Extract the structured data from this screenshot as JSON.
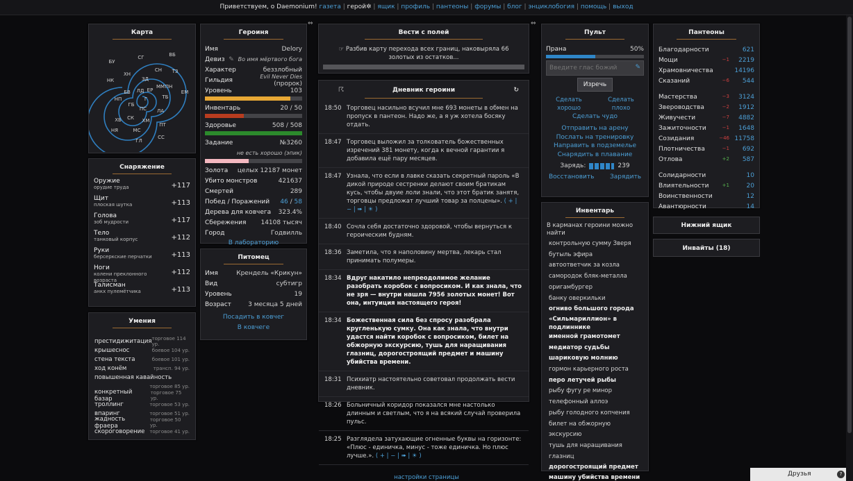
{
  "top": {
    "greet": "Приветствуем, о Daemonium!",
    "links": [
      "газета",
      "ящик",
      "профиль",
      "пантеоны",
      "форумы",
      "блог",
      "энциклобогия",
      "помощь",
      "выход"
    ],
    "hero": "герой"
  },
  "map": {
    "title": "Карта",
    "labels": [
      "СГ",
      "ВБ",
      "БУ",
      "СН",
      "ТЗ",
      "ХН",
      "ЗД",
      "НК",
      "ММ",
      "ПН",
      "ЕМ",
      "БВ",
      "ЛД",
      "ЕР",
      "ТБ",
      "НП",
      "Г",
      "ГБ",
      "ПС",
      "ЛА",
      "ХБ",
      "СК",
      "ХМ",
      "ПТ",
      "НЯ",
      "МС",
      "СС",
      "ГЛ"
    ]
  },
  "hero": {
    "title": "Героиня",
    "rows": [
      {
        "k": "Имя",
        "v": "Delory"
      },
      {
        "k": "Девиз",
        "v": "Во имя мёртвого бога"
      },
      {
        "k": "Характер",
        "v": "беззлобный"
      },
      {
        "k": "Гильдия",
        "v": "Evil Never Dies",
        "v2": "(пророк)"
      },
      {
        "k": "Уровень",
        "v": "103"
      },
      {
        "k": "Инвентарь",
        "v": "20 / 50"
      },
      {
        "k": "Здоровье",
        "v": "508 / 508"
      },
      {
        "k": "Задание",
        "v": "№3260"
      },
      {
        "v": "не есть хорошо (эпик)"
      },
      {
        "k": "Золота",
        "v": "целых 12187 монет"
      },
      {
        "k": "Убито монстров",
        "v": "421637"
      },
      {
        "k": "Смертей",
        "v": "289"
      },
      {
        "k": "Побед / Поражений",
        "v": "46",
        "v2": "58"
      },
      {
        "k": "Дерева для ковчега",
        "v": "323.4%"
      },
      {
        "k": "Сбережения",
        "v": "14108 тысяч"
      },
      {
        "k": "Город",
        "v": "Годвилль"
      }
    ],
    "lab": "В лабораторию",
    "lvl_pct": 88,
    "inv_pct": 40,
    "hp_pct": 100,
    "quest_pct": 45
  },
  "pet": {
    "title": "Питомец",
    "rows": [
      {
        "k": "Имя",
        "v": "Крендель «Крикун»"
      },
      {
        "k": "Вид",
        "v": "субтигр"
      },
      {
        "k": "Уровень",
        "v": "19"
      },
      {
        "k": "Возраст",
        "v": "3 месяца 5 дней"
      }
    ],
    "l1": "Посадить в ковчег",
    "l2": "В ковчеге"
  },
  "equip": {
    "title": "Снаряжение",
    "items": [
      {
        "n": "Оружие",
        "s": "орудие труда",
        "b": "+117"
      },
      {
        "n": "Щит",
        "s": "плоская шутка",
        "b": "+113"
      },
      {
        "n": "Голова",
        "s": "зоб мудрости",
        "b": "+117"
      },
      {
        "n": "Тело",
        "s": "танковый корпус",
        "b": "+112"
      },
      {
        "n": "Руки",
        "s": "берсеркские перчатки",
        "b": "+113"
      },
      {
        "n": "Ноги",
        "s": "колени преклонного возраста",
        "b": "+112"
      },
      {
        "n": "Талисман",
        "s": "анкх пулемётчика",
        "b": "+113"
      }
    ]
  },
  "skills": {
    "title": "Умения",
    "items": [
      {
        "n": "престидижитация",
        "l": "торговое 114 ур."
      },
      {
        "n": "крышеснос",
        "l": "боевое 104 ур."
      },
      {
        "n": "стена текста",
        "l": "боевое 101 ур."
      },
      {
        "n": "ход конём",
        "l": "трансп. 94 ур."
      },
      {
        "n": "повышенная кавайность",
        "l": ""
      },
      {
        "n": "",
        "l": "торговое 85 ур."
      },
      {
        "n": "конкретный базар",
        "l": "торговое 75 ур."
      },
      {
        "n": "троллинг",
        "l": "торговое 53 ур."
      },
      {
        "n": "впаринг",
        "l": "торговое 51 ур."
      },
      {
        "n": "жадность фраера",
        "l": "торговое 50 ур."
      },
      {
        "n": "скороговорение",
        "l": "торговое 41 ур."
      }
    ]
  },
  "news": {
    "title": "Вести с полей",
    "text": "Разбив карту перехода всех границ, наковыряла 66 золотых из остатков..."
  },
  "diary": {
    "title": "Дневник героини",
    "entries": [
      {
        "t": "18:50",
        "x": "Торговец насильно всучил мне 693 монеты в обмен на пропуск в пантеон. Надо же, а я уж хотела босяку отдать."
      },
      {
        "t": "18:47",
        "x": "Торговец выложил за толкователь божественных изречений 381 монету, когда к вечной гарантии я добавила ещё пару месяцев."
      },
      {
        "t": "18:47",
        "x": "Узнала, что если в лавке сказать секретный пароль «В дикой природе сестренки делают своим братикам кусь, чтобы двуие лоли знали, что этот братик занятя, торговцы предложат лучший товар за полцены».",
        "c": "( + | − | ➠ | ☀ )"
      },
      {
        "t": "18:40",
        "x": "Сочла себя достаточно здоровой, чтобы вернуться к героическим будням."
      },
      {
        "t": "18:36",
        "x": "Заметила, что я наполовину мертва, лекарь стал принимать полумеры."
      },
      {
        "t": "18:34",
        "x": "Вдруг накатило непреодолимое желание разобрать коробок с вопросиком. И как знала, что не зря — внутри нашла 7956 золотых монет! Вот она, интуиция настоящего героя!",
        "bold": true
      },
      {
        "t": "18:34",
        "x": "Божественная сила без спросу разобрала кругленькую сумку. Она как знала, что внутри удастся найти коробок с вопросиком, билет на обжорную экскурсию, тушь для наращивания глазниц, дорогостроящий предмет и машину убийства времени.",
        "bold": true
      },
      {
        "t": "18:31",
        "x": "Психиатр настоятельно советовал продолжать вести дневник."
      },
      {
        "t": "18:26",
        "x": "Больничный коридор показался мне настолько длинным и светлым, что я на всякий случай проверила пульс."
      },
      {
        "t": "18:25",
        "x": "Разглядела затухающие огненные буквы на горизонте: «Плюс - единичка, минус - тоже единичка. Но плюс лучше.».",
        "c": "( + | − | ➠ | ☀ )"
      }
    ]
  },
  "remote": {
    "title": "Пульт",
    "prana": "Прана",
    "prana_val": "50%",
    "prana_pct": 50,
    "placeholder": "Введите глас божий",
    "say": "Изречь",
    "good": "Сделать хорошо",
    "bad": "Сделать плохо",
    "miracle": "Сделать чудо",
    "links": [
      "Отправить на арену",
      "Послать на тренировку",
      "Направить в подземелье",
      "Снарядить в плавание"
    ],
    "charges_label": "Зарядь:",
    "charges": "239",
    "restore": "Восстановить",
    "charge": "Зарядить"
  },
  "inventory": {
    "title": "Инвентарь",
    "intro": "В карманах героини можно найти",
    "items": [
      {
        "n": "контрольную сумму Зверя"
      },
      {
        "n": "бутыль эфира"
      },
      {
        "n": "автоответчик за козла"
      },
      {
        "n": "самородок бляк-металла"
      },
      {
        "n": "оригамбургер"
      },
      {
        "n": "банку оверкильки"
      },
      {
        "n": "огниво большого города",
        "b": true
      },
      {
        "n": "«Сильмариллион» в подлиннике",
        "b": true
      },
      {
        "n": "именной грамотомет",
        "b": true
      },
      {
        "n": "медиатор судьбы",
        "b": true
      },
      {
        "n": "шариковую молнию",
        "b": true
      },
      {
        "n": "гормон карьерного роста"
      },
      {
        "n": "перо летучей рыбы",
        "b": true
      },
      {
        "n": "рыбу фугу ре минор"
      },
      {
        "n": "телефонный аллоэ"
      },
      {
        "n": "рыбу голодного копчения"
      },
      {
        "n": "билет на обжорную экскурсию"
      },
      {
        "n": "тушь для наращивания глазниц"
      },
      {
        "n": "дорогостроящий предмет",
        "b": true
      },
      {
        "n": "машину убийства времени",
        "b": true
      }
    ]
  },
  "pantheons": {
    "title": "Пантеоны",
    "items": [
      {
        "n": "Благодарности",
        "d": "",
        "v": "621"
      },
      {
        "n": "Мощи",
        "d": "−1",
        "v": "2219"
      },
      {
        "n": "Храмовничества",
        "d": "",
        "v": "14196"
      },
      {
        "n": "Сказаний",
        "d": "−6",
        "v": "544"
      },
      {
        "n": "Мастерства",
        "d": "−3",
        "v": "3124"
      },
      {
        "n": "Звероводства",
        "d": "−2",
        "v": "1912"
      },
      {
        "n": "Живучести",
        "d": "−7",
        "v": "4882"
      },
      {
        "n": "Зажиточности",
        "d": "−1",
        "v": "1648"
      },
      {
        "n": "Созидания",
        "d": "−46",
        "v": "11758"
      },
      {
        "n": "Плотничества",
        "d": "−1",
        "v": "692"
      },
      {
        "n": "Отлова",
        "d": "+2",
        "v": "587"
      },
      {
        "n": "Солидарности",
        "d": "",
        "v": "10"
      },
      {
        "n": "Влиятельности",
        "d": "+1",
        "v": "20"
      },
      {
        "n": "Воинственности",
        "d": "",
        "v": "12"
      },
      {
        "n": "Авантюрности",
        "d": "",
        "v": "14"
      }
    ]
  },
  "lower_box": "Нижний ящик",
  "invites": "Инвайты (18)",
  "footer": "настройки страницы",
  "friends": "Друзья"
}
